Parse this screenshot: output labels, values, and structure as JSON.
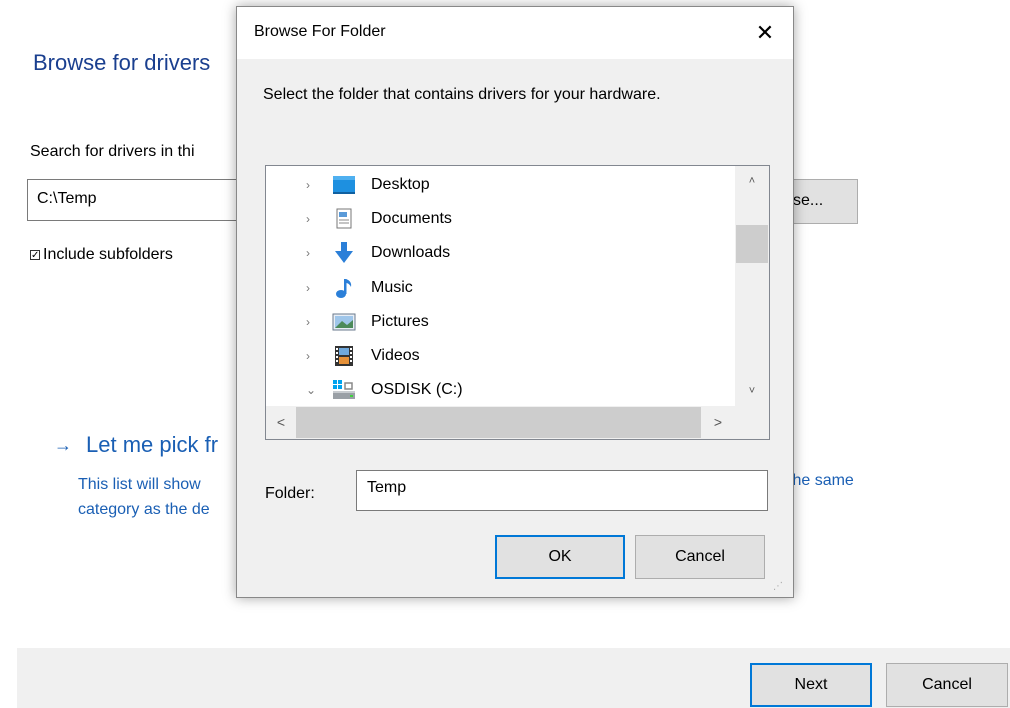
{
  "wizard": {
    "title": "Browse for drivers",
    "search_label": "Search for drivers in thi",
    "path_value": "C:\\Temp",
    "browse_label": "se...",
    "include_subfolders_label": "Include subfolders",
    "include_subfolders_checked": true,
    "pick_arrow": "→",
    "pick_title": "Let me pick fr",
    "pick_desc_line1": "This list will show",
    "pick_desc_line2": "category as the de",
    "pick_desc_right": "the same",
    "footer": {
      "next_label": "Next",
      "cancel_label": "Cancel"
    }
  },
  "dialog": {
    "title": "Browse For Folder",
    "close_glyph": "✕",
    "prompt": "Select the folder that contains drivers for your hardware.",
    "tree": {
      "items": [
        {
          "label": "Desktop",
          "icon": "desktop-icon",
          "expand": "›"
        },
        {
          "label": "Documents",
          "icon": "documents-icon",
          "expand": "›"
        },
        {
          "label": "Downloads",
          "icon": "downloads-icon",
          "expand": "›"
        },
        {
          "label": "Music",
          "icon": "music-icon",
          "expand": "›"
        },
        {
          "label": "Pictures",
          "icon": "pictures-icon",
          "expand": "›"
        },
        {
          "label": "Videos",
          "icon": "videos-icon",
          "expand": "›"
        },
        {
          "label": "OSDISK (C:)",
          "icon": "drive-icon",
          "expand": "⌄"
        }
      ]
    },
    "scroll": {
      "up": "˄",
      "down": "˅",
      "left": "<",
      "right": ">"
    },
    "folder_label": "Folder:",
    "folder_value": "Temp",
    "ok_label": "OK",
    "cancel_label": "Cancel"
  },
  "colors": {
    "accent": "#0078d7",
    "link": "#1a5fb4",
    "title_blue": "#1a3f8f"
  }
}
